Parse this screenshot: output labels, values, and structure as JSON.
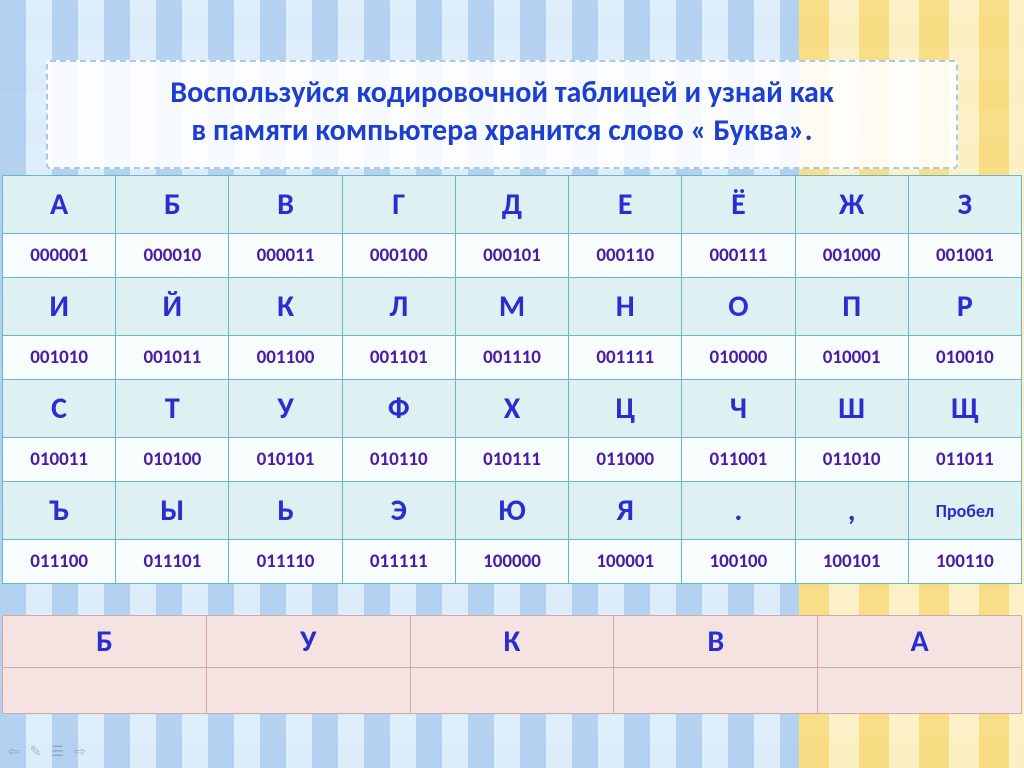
{
  "title": {
    "line1": "Воспользуйся кодировочной таблицей  и узнай как",
    "line2": "в памяти компьютера хранится слово « Буква»."
  },
  "coding_table": {
    "row1_letters": [
      "А",
      "Б",
      "В",
      "Г",
      "Д",
      "Е",
      "Ё",
      "Ж",
      "З"
    ],
    "row1_codes": [
      "000001",
      "000010",
      "000011",
      "000100",
      "000101",
      "000110",
      "000111",
      "001000",
      "001001"
    ],
    "row2_letters": [
      "И",
      "Й",
      "К",
      "Л",
      "М",
      "Н",
      "О",
      "П",
      "Р"
    ],
    "row2_codes": [
      "001010",
      "001011",
      "001100",
      "001101",
      "001110",
      "001111",
      "010000",
      "010001",
      "010010"
    ],
    "row3_letters": [
      "С",
      "Т",
      "У",
      "Ф",
      "Х",
      "Ц",
      "Ч",
      "Ш",
      "Щ"
    ],
    "row3_codes": [
      "010011",
      "010100",
      "010101",
      "010110",
      "010111",
      "011000",
      "011001",
      "011010",
      "011011"
    ],
    "row4_letters": [
      "Ъ",
      "Ы",
      "Ь",
      "Э",
      "Ю",
      "Я",
      ".",
      ",",
      "Пробел"
    ],
    "row4_codes": [
      "011100",
      "011101",
      "011110",
      "011111",
      "100000",
      "100001",
      "100100",
      "100101",
      "100110"
    ]
  },
  "answer": {
    "letters": [
      "Б",
      "У",
      "К",
      "В",
      "А"
    ],
    "codes": [
      "",
      "",
      "",
      "",
      ""
    ]
  },
  "toolbar": {
    "prev": "⇦",
    "pen": "✎",
    "menu": "☰",
    "next": "⇨"
  }
}
